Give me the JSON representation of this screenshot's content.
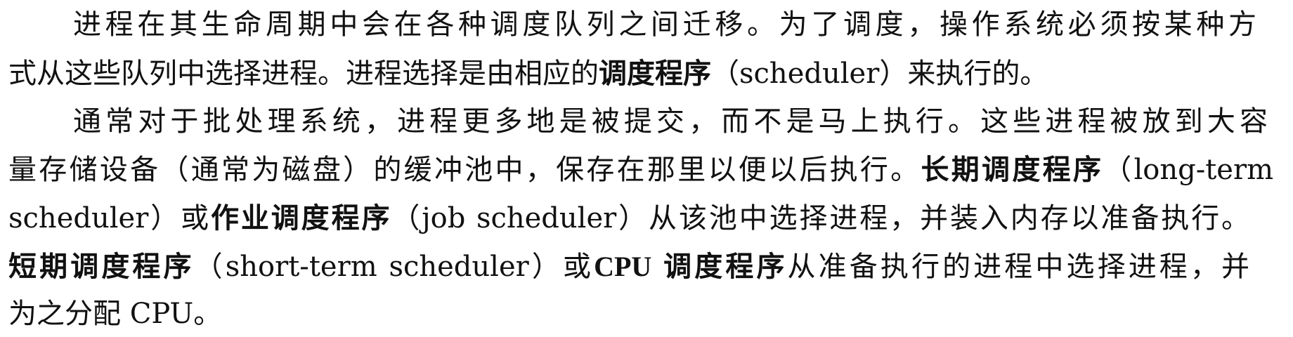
{
  "paragraph1": {
    "line1": "进程在其生命周期中会在各种调度队列之间迁移。为了调度，操作系统必须按某种方",
    "line2_a": "式从这些队列中选择进程。进程选择是由相应的",
    "line2_b": "调度程序",
    "line2_c": "（scheduler）来执行的。"
  },
  "paragraph2": {
    "line3": "通常对于批处理系统，进程更多地是被提交，而不是马上执行。这些进程被放到大容",
    "line4_a": "量存储设备（通常为磁盘）的缓冲池中，保存在那里以便以后执行。",
    "line4_b": "长期调度程序",
    "line4_c": "（long-term",
    "line5_a": "scheduler）或",
    "line5_b": "作业调度程序",
    "line5_c": "（job scheduler）从该池中选择进程，并装入内存以准备执行。",
    "line6_a": "短期调度程序",
    "line6_b": "（short-term scheduler）或",
    "line6_c": "CPU",
    "line6_d": "调度程序",
    "line6_e": "从准备执行的进程中选择进程，并",
    "line7": "为之分配 CPU。"
  }
}
